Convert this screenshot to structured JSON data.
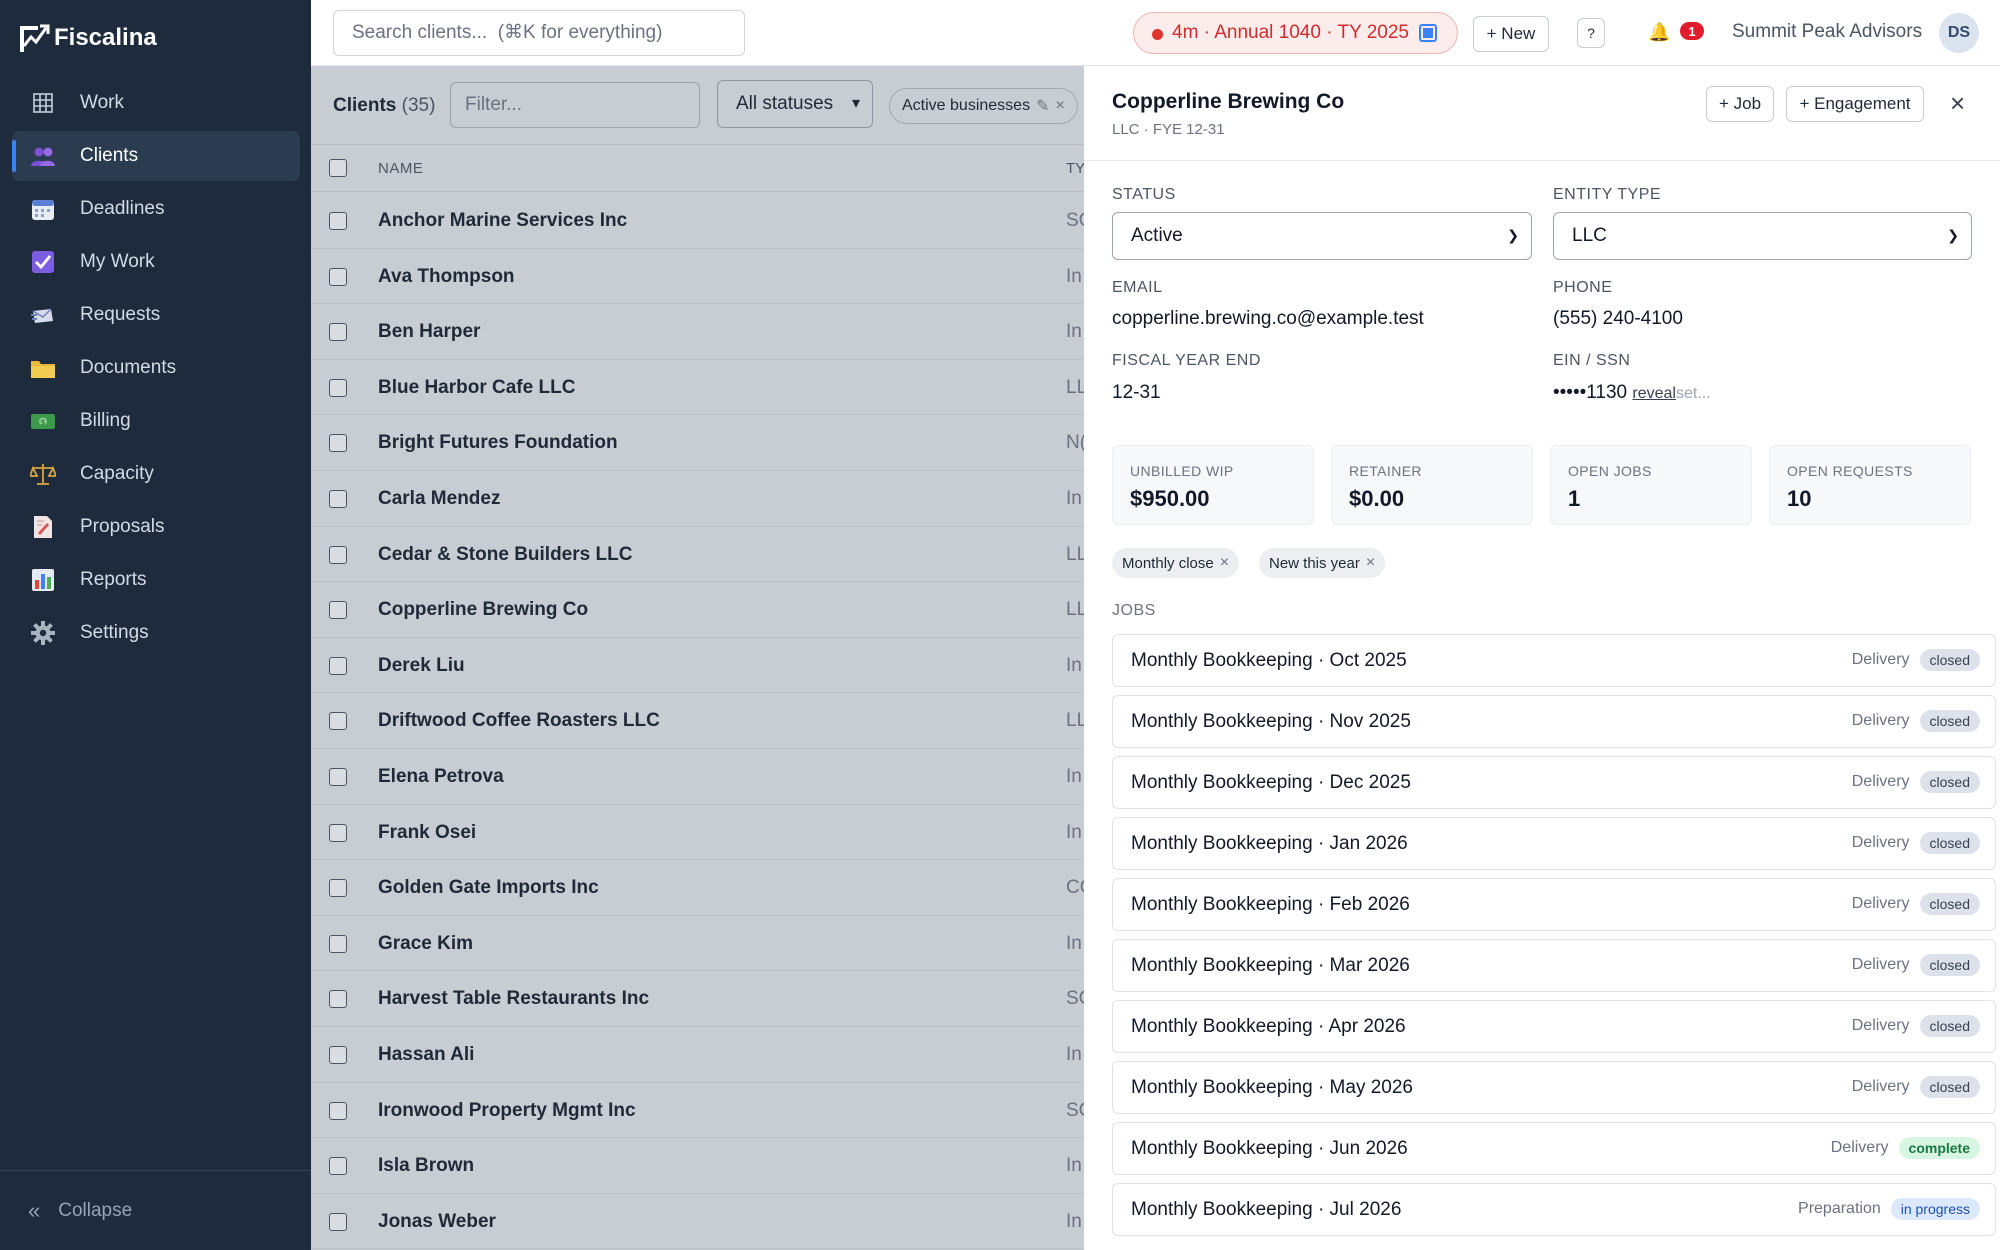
{
  "app": {
    "name": "Fiscalina"
  },
  "sidebar": {
    "items": [
      {
        "label": "Work",
        "icon": "grid-icon"
      },
      {
        "label": "Clients",
        "icon": "people-icon",
        "active": true
      },
      {
        "label": "Deadlines",
        "icon": "calendar-icon"
      },
      {
        "label": "My Work",
        "icon": "checkbox-icon"
      },
      {
        "label": "Requests",
        "icon": "envelope-icon"
      },
      {
        "label": "Documents",
        "icon": "folder-icon"
      },
      {
        "label": "Billing",
        "icon": "money-icon"
      },
      {
        "label": "Capacity",
        "icon": "scales-icon"
      },
      {
        "label": "Proposals",
        "icon": "proposal-icon"
      },
      {
        "label": "Reports",
        "icon": "bar-chart-icon"
      },
      {
        "label": "Settings",
        "icon": "gear-icon"
      }
    ],
    "collapse_label": "Collapse"
  },
  "topbar": {
    "search_placeholder": "Search clients...  (⌘K for everything)",
    "timer_text": "4m · Annual 1040 · TY 2025",
    "new_label": "+ New",
    "help_label": "?",
    "notification_count": "1",
    "firm_name": "Summit Peak Advisors",
    "avatar_initials": "DS"
  },
  "list": {
    "title": "Clients",
    "count": "(35)",
    "filter_placeholder": "Filter...",
    "status_filter": "All statuses",
    "saved_filter": "Active businesses",
    "col_name": "NAME",
    "col_type": "TY",
    "clients": [
      {
        "name": "Anchor Marine Services Inc",
        "type": "SC"
      },
      {
        "name": "Ava Thompson",
        "type": "In"
      },
      {
        "name": "Ben Harper",
        "type": "In"
      },
      {
        "name": "Blue Harbor Cafe LLC",
        "type": "LL"
      },
      {
        "name": "Bright Futures Foundation",
        "type": "N("
      },
      {
        "name": "Carla Mendez",
        "type": "In"
      },
      {
        "name": "Cedar & Stone Builders LLC",
        "type": "LL"
      },
      {
        "name": "Copperline Brewing Co",
        "type": "LL"
      },
      {
        "name": "Derek Liu",
        "type": "In"
      },
      {
        "name": "Driftwood Coffee Roasters LLC",
        "type": "LL"
      },
      {
        "name": "Elena Petrova",
        "type": "In"
      },
      {
        "name": "Frank Osei",
        "type": "In"
      },
      {
        "name": "Golden Gate Imports Inc",
        "type": "CC"
      },
      {
        "name": "Grace Kim",
        "type": "In"
      },
      {
        "name": "Harvest Table Restaurants Inc",
        "type": "SC"
      },
      {
        "name": "Hassan Ali",
        "type": "In"
      },
      {
        "name": "Ironwood Property Mgmt Inc",
        "type": "SC"
      },
      {
        "name": "Isla Brown",
        "type": "In"
      },
      {
        "name": "Jonas Weber",
        "type": "In"
      }
    ]
  },
  "detail": {
    "name": "Copperline Brewing Co",
    "subtitle": "LLC · FYE 12-31",
    "add_job_label": "+ Job",
    "add_engagement_label": "+ Engagement",
    "close_label": "×",
    "status_label": "STATUS",
    "status_value": "Active",
    "entity_label": "ENTITY TYPE",
    "entity_value": "LLC",
    "email_label": "EMAIL",
    "email_value": "copperline.brewing.co@example.test",
    "phone_label": "PHONE",
    "phone_value": "(555) 240-4100",
    "fye_label": "FISCAL YEAR END",
    "fye_value": "12-31",
    "ein_label": "EIN / SSN",
    "ein_value": "•••••1130",
    "reveal_label": "reveal",
    "set_label": "set...",
    "stats": [
      {
        "label": "UNBILLED WIP",
        "value": "$950.00"
      },
      {
        "label": "RETAINER",
        "value": "$0.00"
      },
      {
        "label": "OPEN JOBS",
        "value": "1"
      },
      {
        "label": "OPEN REQUESTS",
        "value": "10"
      }
    ],
    "tags": [
      "Monthly close",
      "New this year"
    ],
    "jobs_label": "JOBS",
    "jobs": [
      {
        "name": "Monthly Bookkeeping · Oct 2025",
        "phase": "Delivery",
        "status": "closed"
      },
      {
        "name": "Monthly Bookkeeping · Nov 2025",
        "phase": "Delivery",
        "status": "closed"
      },
      {
        "name": "Monthly Bookkeeping · Dec 2025",
        "phase": "Delivery",
        "status": "closed"
      },
      {
        "name": "Monthly Bookkeeping · Jan 2026",
        "phase": "Delivery",
        "status": "closed"
      },
      {
        "name": "Monthly Bookkeeping · Feb 2026",
        "phase": "Delivery",
        "status": "closed"
      },
      {
        "name": "Monthly Bookkeeping · Mar 2026",
        "phase": "Delivery",
        "status": "closed"
      },
      {
        "name": "Monthly Bookkeeping · Apr 2026",
        "phase": "Delivery",
        "status": "closed"
      },
      {
        "name": "Monthly Bookkeeping · May 2026",
        "phase": "Delivery",
        "status": "closed"
      },
      {
        "name": "Monthly Bookkeeping · Jun 2026",
        "phase": "Delivery",
        "status": "complete"
      },
      {
        "name": "Monthly Bookkeeping · Jul 2026",
        "phase": "Preparation",
        "status": "in progress"
      }
    ]
  }
}
